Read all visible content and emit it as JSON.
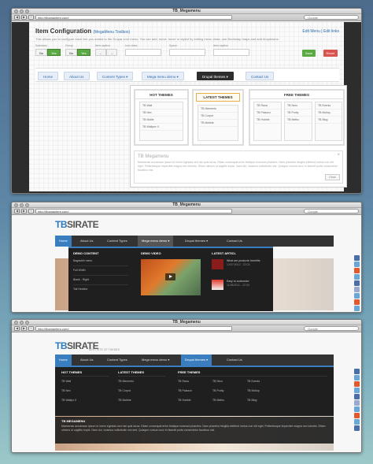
{
  "browser": {
    "title": "TB_Megamenu",
    "url": "http://thamaxtem.com/",
    "search_placeholder": "Google",
    "back": "◀",
    "forward": "▶",
    "plus": "+"
  },
  "admin": {
    "title": "Item Configuration",
    "toolbox": "(MegaMenu Toolbox)",
    "links": "Edit Menu | Edit links",
    "description": "This allows you to configure each line you added to the Drupal core menu. You can add, move, hover or styled by editing menu class, use Bootstrap maps and add dropdowns.",
    "fields": [
      {
        "label": "Submenu",
        "options": [
          "No",
          "Yes"
        ],
        "selected": 1
      },
      {
        "label": "Group",
        "options": [
          "No",
          "Yes"
        ],
        "selected": 1
      },
      {
        "label": "Item caption",
        "options": [
          "←",
          "→"
        ],
        "selected": -1
      },
      {
        "label": "Icon class",
        "input": true
      },
      {
        "label": "Space",
        "input": true
      },
      {
        "label": "Item caption",
        "input": true
      }
    ],
    "save_label": "Save",
    "reset_label": "Reset",
    "menu": [
      "Home",
      "About Us",
      "Content Types ▾",
      "Mega menu demo ▾",
      "Drupal themes ▾",
      "Contact Us"
    ],
    "columns": [
      {
        "heading": "HOT THEMES",
        "items": [
          "TB Wall",
          "TB Nex",
          "TB Mollie",
          "TB Wallpez II"
        ]
      },
      {
        "heading": "LATEST THEMES",
        "items": [
          "TB Memento",
          "TB Corpot",
          "TB Mollete"
        ]
      },
      {
        "heading": "FREE THEMES",
        "items": [
          [
            "TB Rana",
            "TB Nero",
            "TB Events"
          ],
          [
            "TB Palazzo",
            "TB Purity",
            "TB Mollup"
          ],
          [
            "TB Hubble",
            "TB Methu",
            "TB Blog"
          ]
        ]
      }
    ],
    "intro_title": "TB Megamenu",
    "intro_text": "Maecenas accumsan ipsum id lorem egestas sed nisi quis lacus. Etiam consequat enim tristique euismod pharetra. Nam pharetra fringilla eleifend metus non elit eget. Pellentesque imperdiet magna nec lobortis. Etiam ultrices ut sagittis turpis. Nam dui, vivamus sollicitudin nisi. Quisque cursus nunc in blandit porta consectetur faucibus nisi.",
    "intro_close": "×",
    "intro_btn": "Close"
  },
  "site": {
    "logo_a": "TB",
    "logo_b": "SIRATE",
    "slogan": "BEST SITE OF THEMES",
    "nav": [
      "Home",
      "About Us",
      "Content Types",
      "Mega menu demo ▾",
      "Drupal themes ▾",
      "Contact Us"
    ],
    "demo1": {
      "headings": [
        "DEMO CONTENT",
        "DEMO VIDEO",
        "LATEST ARTICL"
      ],
      "links": [
        "Bagasbih menu",
        "Full Width",
        "Blank - Right",
        "Tall Hexfdor"
      ],
      "articles": [
        {
          "title": "What are products' benefits",
          "date": "12/07/2012 - 22:03"
        },
        {
          "title": "Easy to customize",
          "date": "11/08/2011 - 22:03"
        }
      ]
    },
    "demo2": {
      "headings": [
        "HOT THEMES",
        "LATEST THEMES",
        "FREE THEMES"
      ],
      "hot": [
        "TB Wall",
        "TB Nex",
        "TB Wallpo II"
      ],
      "latest": [
        "TB Memento",
        "TB Corpot",
        "TB Mollete"
      ],
      "free": [
        [
          "TB Rana",
          "TB Nero",
          "TB Events"
        ],
        [
          "TB Palazzo",
          "TB Purity",
          "TB Mollup"
        ],
        [
          "TB Hubble",
          "TB Methu",
          "TB Blog"
        ]
      ],
      "intro_title": "TB MEGAMENU",
      "intro_text": "Maecenas accumsan ipsum id lorem egestas sed nisi quis lacus. Etiam consequat enim tristique euismod pharetra. Nam pharetra fringilla eleifend metus non elit eget. Pellentesque imperdiet magna nec lobortis. Etiam ultrices ut sagittis turpis. Nam dui, vivamus sollicitudin nisi sed. Quisque cursus nunc in blandit porta consectetur faucibus nisi."
    }
  },
  "colors": {
    "accent": "#3a7ec0",
    "green": "#5aa943",
    "red": "#d9534f",
    "dark": "#2d2d2d",
    "social": [
      "#4a6ea9",
      "#6aa7d9",
      "#e05a2c",
      "#6aa7d9",
      "#4a6ea9",
      "#9ac",
      "#6aa7d9",
      "#e05a2c",
      "#6aa7d9"
    ]
  }
}
